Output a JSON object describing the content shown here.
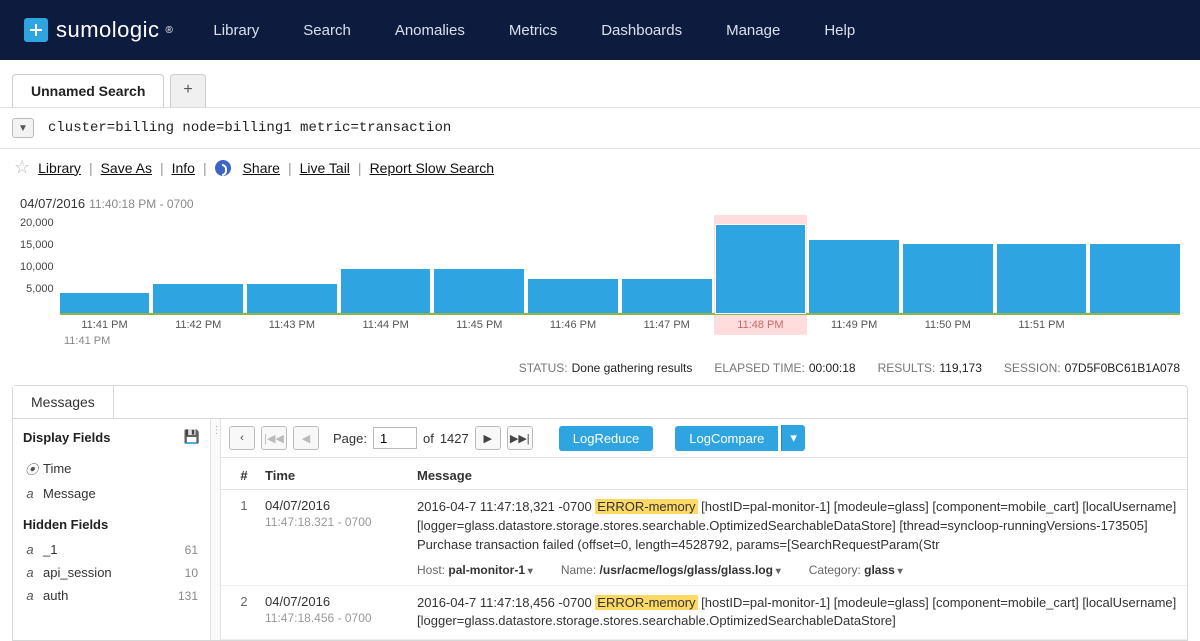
{
  "brand": "sumologic",
  "nav": [
    "Library",
    "Search",
    "Anomalies",
    "Metrics",
    "Dashboards",
    "Manage",
    "Help"
  ],
  "tab": {
    "title": "Unnamed Search",
    "add": "+"
  },
  "query": "cluster=billing node=billing1 metric=transaction",
  "actions": {
    "library": "Library",
    "save_as": "Save As",
    "info": "Info",
    "share": "Share",
    "live_tail": "Live Tail",
    "report": "Report Slow Search"
  },
  "chart_data": {
    "type": "bar",
    "date": "04/07/2016",
    "date_sub": "11:40:18 PM - 0700",
    "yticks": [
      "20,000",
      "15,000",
      "10,000",
      "5,000"
    ],
    "ylim": [
      0,
      20000
    ],
    "categories": [
      "11:41 PM",
      "11:42 PM",
      "11:43 PM",
      "11:44 PM",
      "11:45 PM",
      "11:46 PM",
      "11:47 PM",
      "11:48 PM",
      "11:49 PM",
      "11:50 PM",
      "11:51 PM",
      ""
    ],
    "values": [
      4000,
      6000,
      6000,
      9000,
      9000,
      7000,
      7000,
      18000,
      15000,
      14000,
      14000,
      14000
    ],
    "highlight_index": 7,
    "cursor_time": "11:41 PM"
  },
  "status": {
    "status_k": "STATUS:",
    "status_v": "Done gathering results",
    "elapsed_k": "ELAPSED TIME:",
    "elapsed_v": "00:00:18",
    "results_k": "RESULTS:",
    "results_v": "119,173",
    "session_k": "SESSION:",
    "session_v": "07D5F0BC61B1A078"
  },
  "panel": {
    "tab": "Messages",
    "display_fields": "Display Fields",
    "hidden_fields": "Hidden Fields",
    "display_items": [
      {
        "type": "⦿",
        "label": "Time"
      },
      {
        "type": "a",
        "label": "Message"
      }
    ],
    "hidden_items": [
      {
        "type": "a",
        "label": "_1",
        "count": "61"
      },
      {
        "type": "a",
        "label": "api_session",
        "count": "10"
      },
      {
        "type": "a",
        "label": "auth",
        "count": "131"
      }
    ]
  },
  "pager": {
    "page_label": "Page:",
    "page": "1",
    "of": "of",
    "total": "1427",
    "logreduce": "LogReduce",
    "logcompare": "LogCompare"
  },
  "grid": {
    "head": {
      "idx": "#",
      "time": "Time",
      "msg": "Message"
    },
    "rows": [
      {
        "idx": "1",
        "time": {
          "main": "04/07/2016",
          "sub": "11:47:18.321 - 0700"
        },
        "msg_pre": "2016-04-7 11:47:18,321 -0700 ",
        "msg_hl": "ERROR-memory",
        "msg_post": " [hostID=pal-monitor-1] [modeule=glass] [component=mobile_cart] [localUsername] [logger=glass.datastore.storage.stores.searchable.OptimizedSearchableDataStore] [thread=syncloop-runningVersions-173505] Purchase transaction failed (offset=0, length=4528792, params=[SearchRequestParam(Str",
        "meta": {
          "host_k": "Host:",
          "host_v": "pal-monitor-1",
          "name_k": "Name:",
          "name_v": "/usr/acme/logs/glass/glass.log",
          "cat_k": "Category:",
          "cat_v": "glass"
        }
      },
      {
        "idx": "2",
        "time": {
          "main": "04/07/2016",
          "sub": "11:47:18.456 - 0700"
        },
        "msg_pre": "2016-04-7 11:47:18,456 -0700 ",
        "msg_hl": "ERROR-memory",
        "msg_post": " [hostID=pal-monitor-1] [modeule=glass] [component=mobile_cart] [localUsername] [logger=glass.datastore.storage.stores.searchable.OptimizedSearchableDataStore]"
      }
    ]
  }
}
